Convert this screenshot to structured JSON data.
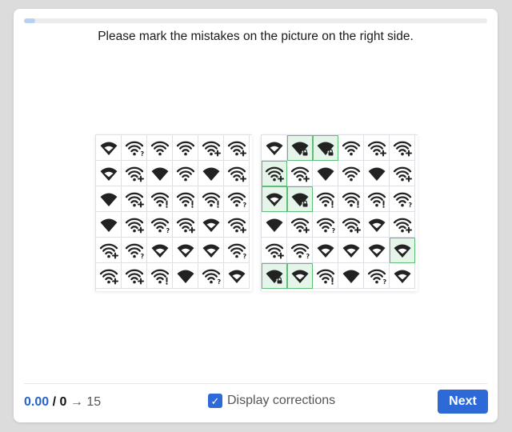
{
  "progress": {
    "fraction": 0.025
  },
  "instruction": "Please mark the mistakes on the picture on the right side.",
  "colors": {
    "accent": "#2d6ad8",
    "mark_fill": "#e6f5e9",
    "mark_border": "#5cbf75",
    "icon": "#222222"
  },
  "left_grid": [
    [
      "wifi-low-icon",
      "wifi-question-icon",
      "wifi-full-icon",
      "wifi-full-icon",
      "wifi-plus-icon",
      "wifi-plus-icon"
    ],
    [
      "wifi-low-icon",
      "wifi-plus-icon",
      "wifi-filled-icon",
      "wifi-full-icon",
      "wifi-filled-icon",
      "wifi-plus-icon"
    ],
    [
      "wifi-filled-icon",
      "wifi-plus-icon",
      "wifi-exclaim-icon",
      "wifi-exclaim-icon",
      "wifi-exclaim-icon",
      "wifi-question-icon"
    ],
    [
      "wifi-filled-icon",
      "wifi-plus-icon",
      "wifi-question-icon",
      "wifi-plus-icon",
      "wifi-low-icon",
      "wifi-plus-icon"
    ],
    [
      "wifi-plus-icon",
      "wifi-question-icon",
      "wifi-low-icon",
      "wifi-low-icon",
      "wifi-low-icon",
      "wifi-question-icon"
    ],
    [
      "wifi-plus-icon",
      "wifi-plus-icon",
      "wifi-exclaim-icon",
      "wifi-filled-icon",
      "wifi-question-icon",
      "wifi-low-icon"
    ]
  ],
  "right_grid": [
    [
      "wifi-low-icon",
      "wifi-lock-icon",
      "wifi-lock-icon",
      "wifi-full-icon",
      "wifi-plus-icon",
      "wifi-plus-icon"
    ],
    [
      "wifi-plus-icon",
      "wifi-plus-icon",
      "wifi-filled-icon",
      "wifi-full-icon",
      "wifi-filled-icon",
      "wifi-plus-icon"
    ],
    [
      "wifi-low-icon",
      "wifi-lock-icon",
      "wifi-exclaim-icon",
      "wifi-exclaim-icon",
      "wifi-exclaim-icon",
      "wifi-question-icon"
    ],
    [
      "wifi-filled-icon",
      "wifi-plus-icon",
      "wifi-question-icon",
      "wifi-plus-icon",
      "wifi-low-icon",
      "wifi-plus-icon"
    ],
    [
      "wifi-plus-icon",
      "wifi-question-icon",
      "wifi-low-icon",
      "wifi-low-icon",
      "wifi-low-icon",
      "wifi-low-icon"
    ],
    [
      "wifi-lock-icon",
      "wifi-low-icon",
      "wifi-exclaim-icon",
      "wifi-filled-icon",
      "wifi-question-icon",
      "wifi-low-icon"
    ]
  ],
  "right_marked": [
    [
      0,
      1
    ],
    [
      0,
      2
    ],
    [
      1,
      0
    ],
    [
      2,
      0
    ],
    [
      2,
      1
    ],
    [
      4,
      5
    ],
    [
      5,
      0
    ],
    [
      5,
      1
    ]
  ],
  "score": {
    "value": "0.00",
    "separator": "/",
    "count": "0",
    "arrow": "→",
    "target": "15"
  },
  "corrections": {
    "label": "Display corrections",
    "checked": true,
    "check_glyph": "✓"
  },
  "next_button": {
    "label": "Next"
  }
}
